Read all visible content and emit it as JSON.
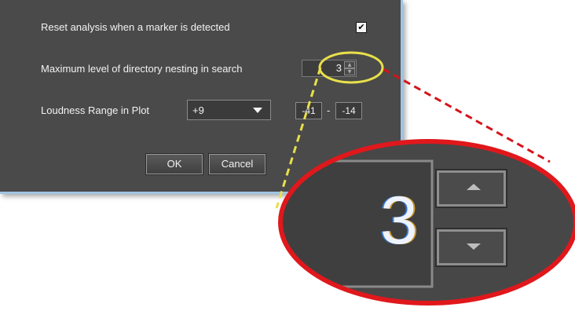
{
  "dialog": {
    "reset_label": "Reset analysis when a marker is detected",
    "reset_checked": true,
    "reset_check_glyph": "✔",
    "nesting_label": "Maximum level of directory nesting in search",
    "nesting_value": "3",
    "spin_up_glyph": "▲",
    "spin_down_glyph": "▼",
    "loudness_label": "Loudness Range in Plot",
    "loudness_selected": "+9",
    "range_min": "-41",
    "range_separator": "-",
    "range_max": "-14",
    "ok_label": "OK",
    "cancel_label": "Cancel"
  },
  "zoom_callout": {
    "value": "3",
    "icons": [
      "arrow-up-icon",
      "arrow-down-icon"
    ]
  },
  "colors": {
    "dialog_bg": "#4a4a4a",
    "window_border": "#9fc4e2",
    "highlight_ellipse": "#e8e04a",
    "zoom_ellipse": "#e0181c"
  }
}
